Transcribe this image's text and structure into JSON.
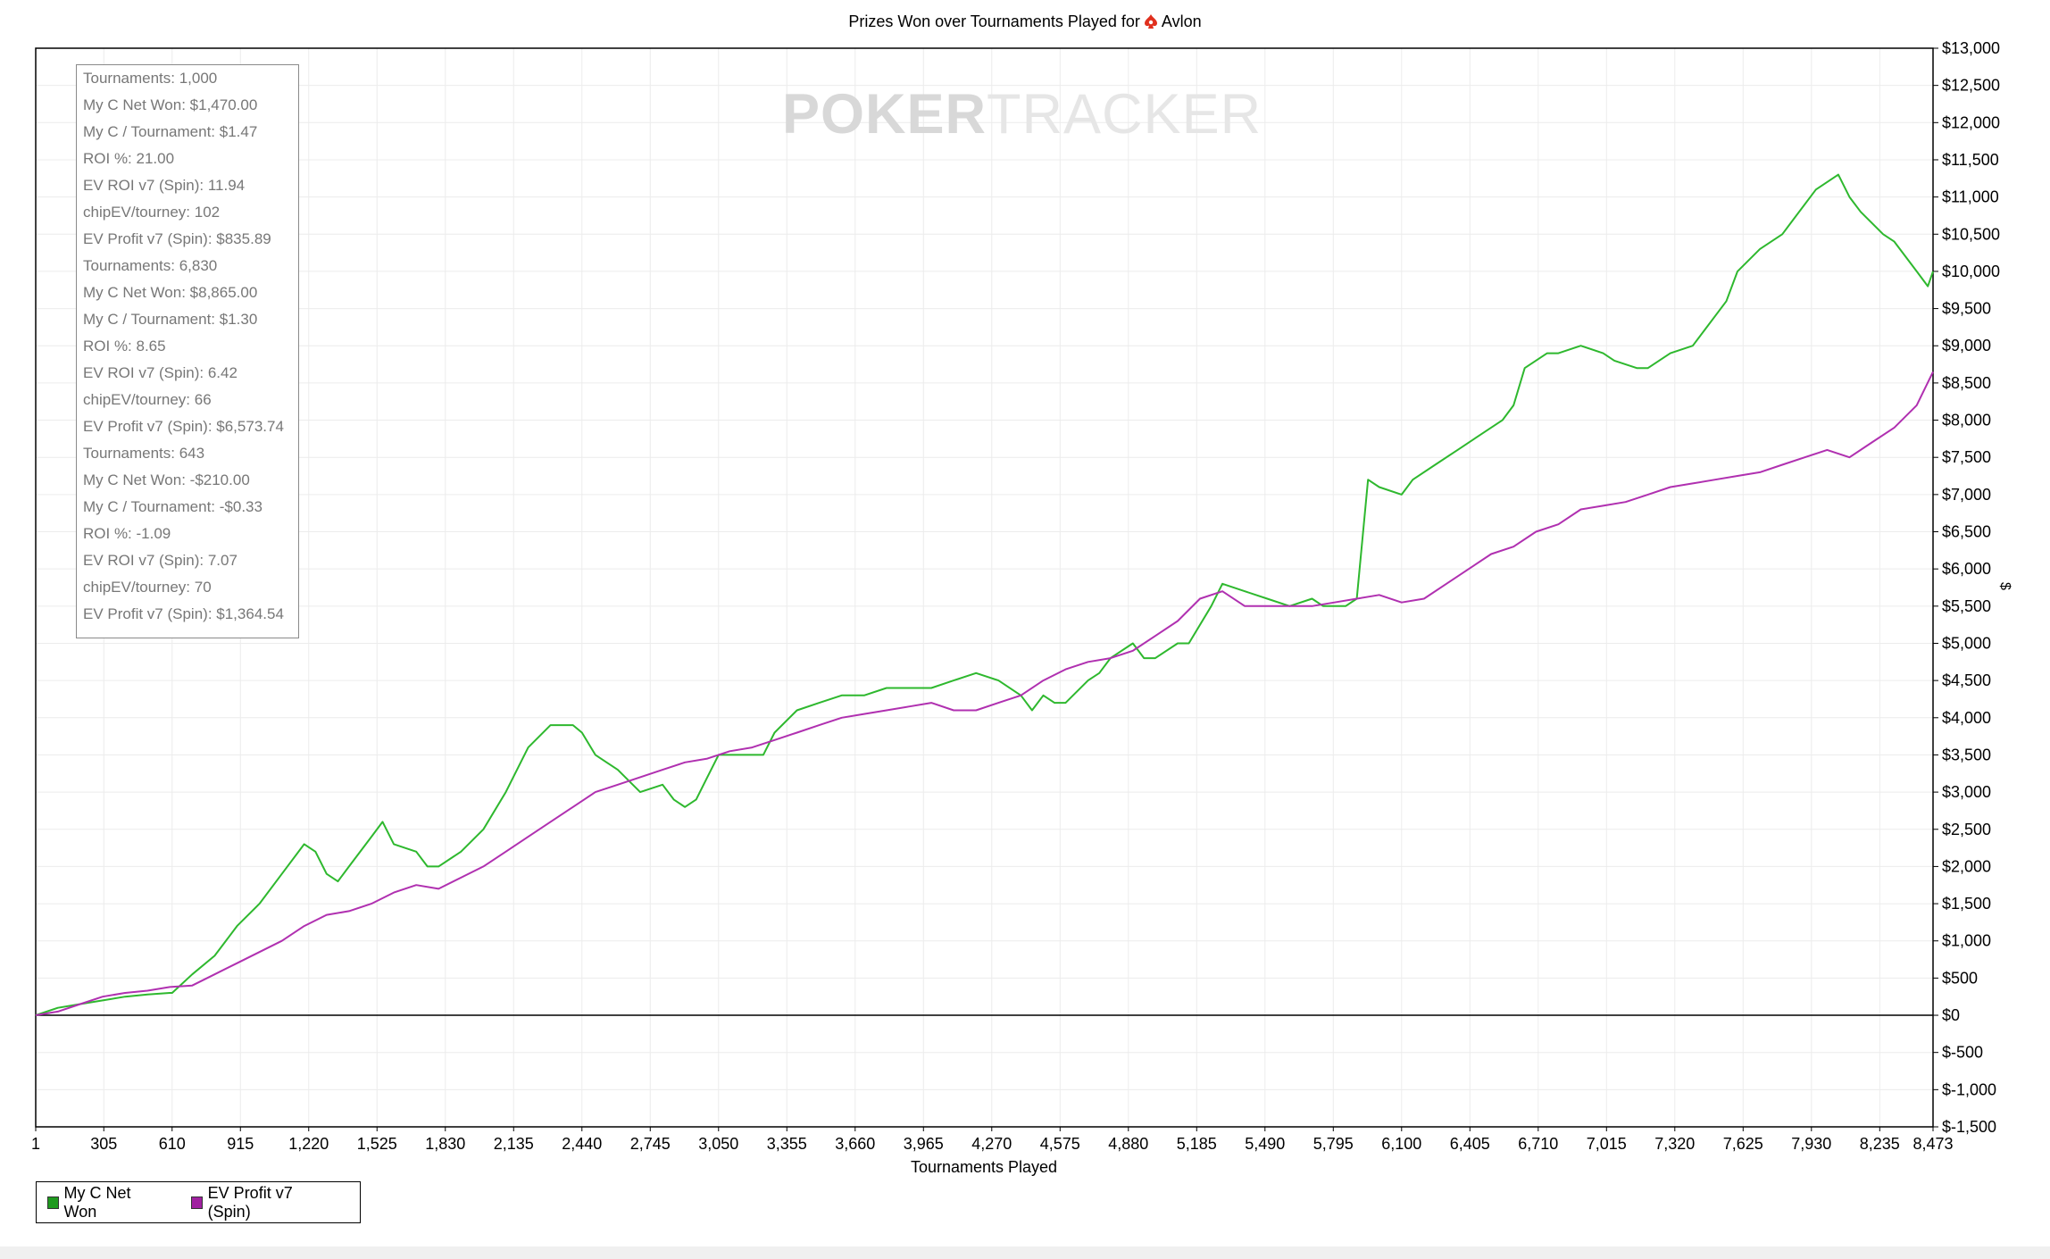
{
  "chart_data": {
    "type": "line",
    "title": "Prizes Won over Tournaments Played for",
    "player": "Avlon",
    "player_icon": "pokerstars-spade-icon",
    "watermark_bold": "POKER",
    "watermark_light": "TRACKER",
    "xlabel": "Tournaments Played",
    "ylabel": "$",
    "xlim": [
      1,
      8473
    ],
    "ylim": [
      -1500,
      13000
    ],
    "grid": true,
    "zero_line": true,
    "legend_position": "bottom-left",
    "x_ticks": [
      "1",
      "305",
      "610",
      "915",
      "1,220",
      "1,525",
      "1,830",
      "2,135",
      "2,440",
      "2,745",
      "3,050",
      "3,355",
      "3,660",
      "3,965",
      "4,270",
      "4,575",
      "4,880",
      "5,185",
      "5,490",
      "5,795",
      "6,100",
      "6,405",
      "6,710",
      "7,015",
      "7,320",
      "7,625",
      "7,930",
      "8,235",
      "8,473"
    ],
    "x_tick_values": [
      1,
      305,
      610,
      915,
      1220,
      1525,
      1830,
      2135,
      2440,
      2745,
      3050,
      3355,
      3660,
      3965,
      4270,
      4575,
      4880,
      5185,
      5490,
      5795,
      6100,
      6405,
      6710,
      7015,
      7320,
      7625,
      7930,
      8235,
      8473
    ],
    "y_ticks": [
      "$13,000",
      "$12,500",
      "$12,000",
      "$11,500",
      "$11,000",
      "$10,500",
      "$10,000",
      "$9,500",
      "$9,000",
      "$8,500",
      "$8,000",
      "$7,500",
      "$7,000",
      "$6,500",
      "$6,000",
      "$5,500",
      "$5,000",
      "$4,500",
      "$4,000",
      "$3,500",
      "$3,000",
      "$2,500",
      "$2,000",
      "$1,500",
      "$1,000",
      "$500",
      "$0",
      "$-500",
      "$-1,000",
      "$-1,500"
    ],
    "y_tick_values": [
      13000,
      12500,
      12000,
      11500,
      11000,
      10500,
      10000,
      9500,
      9000,
      8500,
      8000,
      7500,
      7000,
      6500,
      6000,
      5500,
      5000,
      4500,
      4000,
      3500,
      3000,
      2500,
      2000,
      1500,
      1000,
      500,
      0,
      -500,
      -1000,
      -1500
    ],
    "series": [
      {
        "name": "My C Net Won",
        "color": "#2eb82e",
        "x": [
          1,
          100,
          200,
          300,
          400,
          500,
          600,
          610,
          700,
          800,
          900,
          1000,
          1100,
          1200,
          1250,
          1300,
          1350,
          1400,
          1500,
          1550,
          1600,
          1700,
          1750,
          1800,
          1900,
          2000,
          2100,
          2200,
          2300,
          2400,
          2440,
          2500,
          2550,
          2600,
          2700,
          2800,
          2850,
          2900,
          2950,
          3000,
          3050,
          3150,
          3250,
          3300,
          3400,
          3500,
          3600,
          3700,
          3800,
          3900,
          4000,
          4100,
          4200,
          4300,
          4400,
          4450,
          4500,
          4550,
          4600,
          4700,
          4750,
          4800,
          4900,
          4950,
          5000,
          5100,
          5150,
          5250,
          5300,
          5400,
          5500,
          5600,
          5700,
          5750,
          5850,
          5900,
          5950,
          6000,
          6100,
          6150,
          6250,
          6350,
          6450,
          6550,
          6600,
          6650,
          6750,
          6800,
          6900,
          7000,
          7050,
          7150,
          7200,
          7300,
          7400,
          7450,
          7550,
          7600,
          7700,
          7800,
          7850,
          7950,
          8050,
          8100,
          8150,
          8250,
          8300,
          8400,
          8450,
          8473
        ],
        "y": [
          0,
          100,
          150,
          200,
          250,
          280,
          300,
          300,
          550,
          800,
          1200,
          1500,
          1900,
          2300,
          2200,
          1900,
          1800,
          2000,
          2400,
          2600,
          2300,
          2200,
          2000,
          2000,
          2200,
          2500,
          3000,
          3600,
          3900,
          3900,
          3800,
          3500,
          3400,
          3300,
          3000,
          3100,
          2900,
          2800,
          2900,
          3200,
          3500,
          3500,
          3500,
          3800,
          4100,
          4200,
          4300,
          4300,
          4400,
          4400,
          4400,
          4500,
          4600,
          4500,
          4300,
          4100,
          4300,
          4200,
          4200,
          4500,
          4600,
          4800,
          5000,
          4800,
          4800,
          5000,
          5000,
          5500,
          5800,
          5700,
          5600,
          5500,
          5600,
          5500,
          5500,
          5600,
          7200,
          7100,
          7000,
          7200,
          7400,
          7600,
          7800,
          8000,
          8200,
          8700,
          8900,
          8900,
          9000,
          8900,
          8800,
          8700,
          8700,
          8900,
          9000,
          9200,
          9600,
          10000,
          10300,
          10500,
          10700,
          11100,
          11300,
          11000,
          10800,
          10500,
          10400,
          10000,
          9800,
          10000
        ]
      },
      {
        "name": "EV Profit v7 (Spin)",
        "color": "#b030b0",
        "x": [
          1,
          100,
          200,
          300,
          400,
          500,
          600,
          700,
          800,
          900,
          1000,
          1100,
          1200,
          1300,
          1400,
          1500,
          1600,
          1700,
          1800,
          1900,
          2000,
          2100,
          2200,
          2300,
          2400,
          2500,
          2600,
          2700,
          2800,
          2900,
          3000,
          3100,
          3200,
          3300,
          3400,
          3500,
          3600,
          3700,
          3800,
          3900,
          4000,
          4100,
          4200,
          4300,
          4400,
          4500,
          4600,
          4700,
          4800,
          4900,
          5000,
          5100,
          5200,
          5300,
          5400,
          5500,
          5600,
          5700,
          5800,
          5900,
          6000,
          6100,
          6200,
          6300,
          6400,
          6500,
          6600,
          6700,
          6800,
          6900,
          7000,
          7100,
          7200,
          7300,
          7400,
          7500,
          7600,
          7700,
          7800,
          7900,
          8000,
          8100,
          8200,
          8300,
          8400,
          8473
        ],
        "y": [
          0,
          50,
          150,
          250,
          300,
          330,
          380,
          400,
          550,
          700,
          850,
          1000,
          1200,
          1350,
          1400,
          1500,
          1650,
          1750,
          1700,
          1850,
          2000,
          2200,
          2400,
          2600,
          2800,
          3000,
          3100,
          3200,
          3300,
          3400,
          3450,
          3550,
          3600,
          3700,
          3800,
          3900,
          4000,
          4050,
          4100,
          4150,
          4200,
          4100,
          4100,
          4200,
          4300,
          4500,
          4650,
          4750,
          4800,
          4900,
          5100,
          5300,
          5600,
          5700,
          5500,
          5500,
          5500,
          5500,
          5550,
          5600,
          5650,
          5550,
          5600,
          5800,
          6000,
          6200,
          6300,
          6500,
          6600,
          6800,
          6850,
          6900,
          7000,
          7100,
          7150,
          7200,
          7250,
          7300,
          7400,
          7500,
          7600,
          7500,
          7700,
          7900,
          8200,
          8650
        ]
      }
    ]
  },
  "stats": [
    "Tournaments: 1,000",
    "My C Net Won: $1,470.00",
    "My C / Tournament: $1.47",
    "ROI %: 21.00",
    "EV ROI v7 (Spin): 11.94",
    "chipEV/tourney: 102",
    "EV Profit v7 (Spin): $835.89",
    "Tournaments: 6,830",
    "My C Net Won: $8,865.00",
    "My C / Tournament: $1.30",
    "ROI %: 8.65",
    "EV ROI v7 (Spin): 6.42",
    "chipEV/tourney: 66",
    "EV Profit v7 (Spin): $6,573.74",
    "Tournaments: 643",
    "My C Net Won: -$210.00",
    "My C / Tournament: -$0.33",
    "ROI %: -1.09",
    "EV ROI v7 (Spin): 7.07",
    "chipEV/tourney: 70",
    "EV Profit v7 (Spin): $1,364.54"
  ],
  "legend": [
    {
      "label": "My C Net Won",
      "color": "#1f9a1f"
    },
    {
      "label": "EV Profit v7 (Spin)",
      "color": "#a020a0"
    }
  ]
}
